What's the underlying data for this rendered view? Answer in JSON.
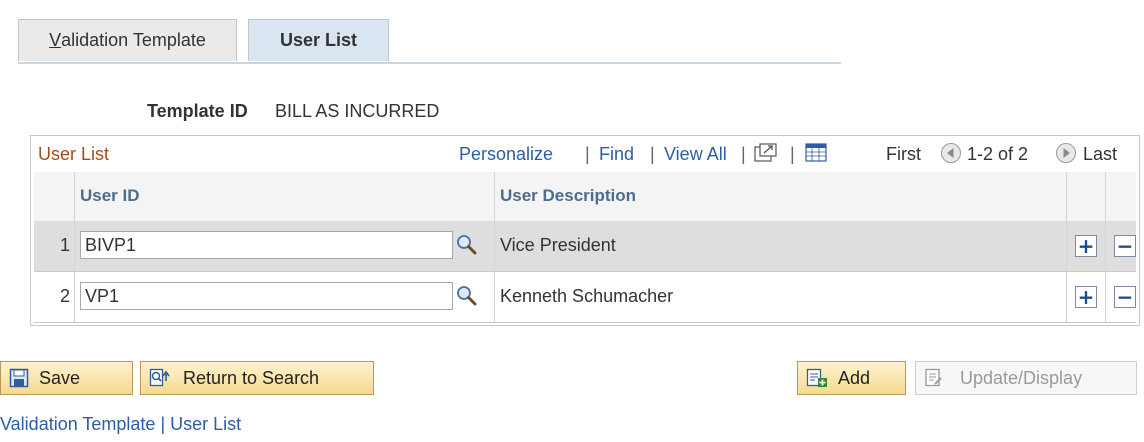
{
  "tabs": [
    {
      "label_first": "V",
      "label_rest": "alidation Template"
    },
    {
      "label": "User List"
    }
  ],
  "template": {
    "label": "Template ID",
    "value": "BILL AS INCURRED"
  },
  "grid": {
    "title": "User List",
    "personalize": "Personalize",
    "find": "Find",
    "view_all": "View All",
    "separator": "|",
    "first": "First",
    "range": "1-2 of 2",
    "last": "Last",
    "columns": {
      "user_id": "User ID",
      "user_description": "User Description"
    },
    "rows": [
      {
        "num": "1",
        "user_id": "BIVP1",
        "description": "Vice President"
      },
      {
        "num": "2",
        "user_id": "VP1",
        "description": "Kenneth Schumacher"
      }
    ],
    "plus": "+",
    "minus": "−"
  },
  "buttons": {
    "save": "Save",
    "return_to_search": "Return to Search",
    "add": "Add",
    "update_display": "Update/Display"
  },
  "footer": {
    "link1": "Validation Template",
    "link2": "User List",
    "separator": "|"
  },
  "colors": {
    "accent_link": "#2b5ea7",
    "grid_title": "#a34d1a",
    "button_yellow": "#f6d98e"
  }
}
